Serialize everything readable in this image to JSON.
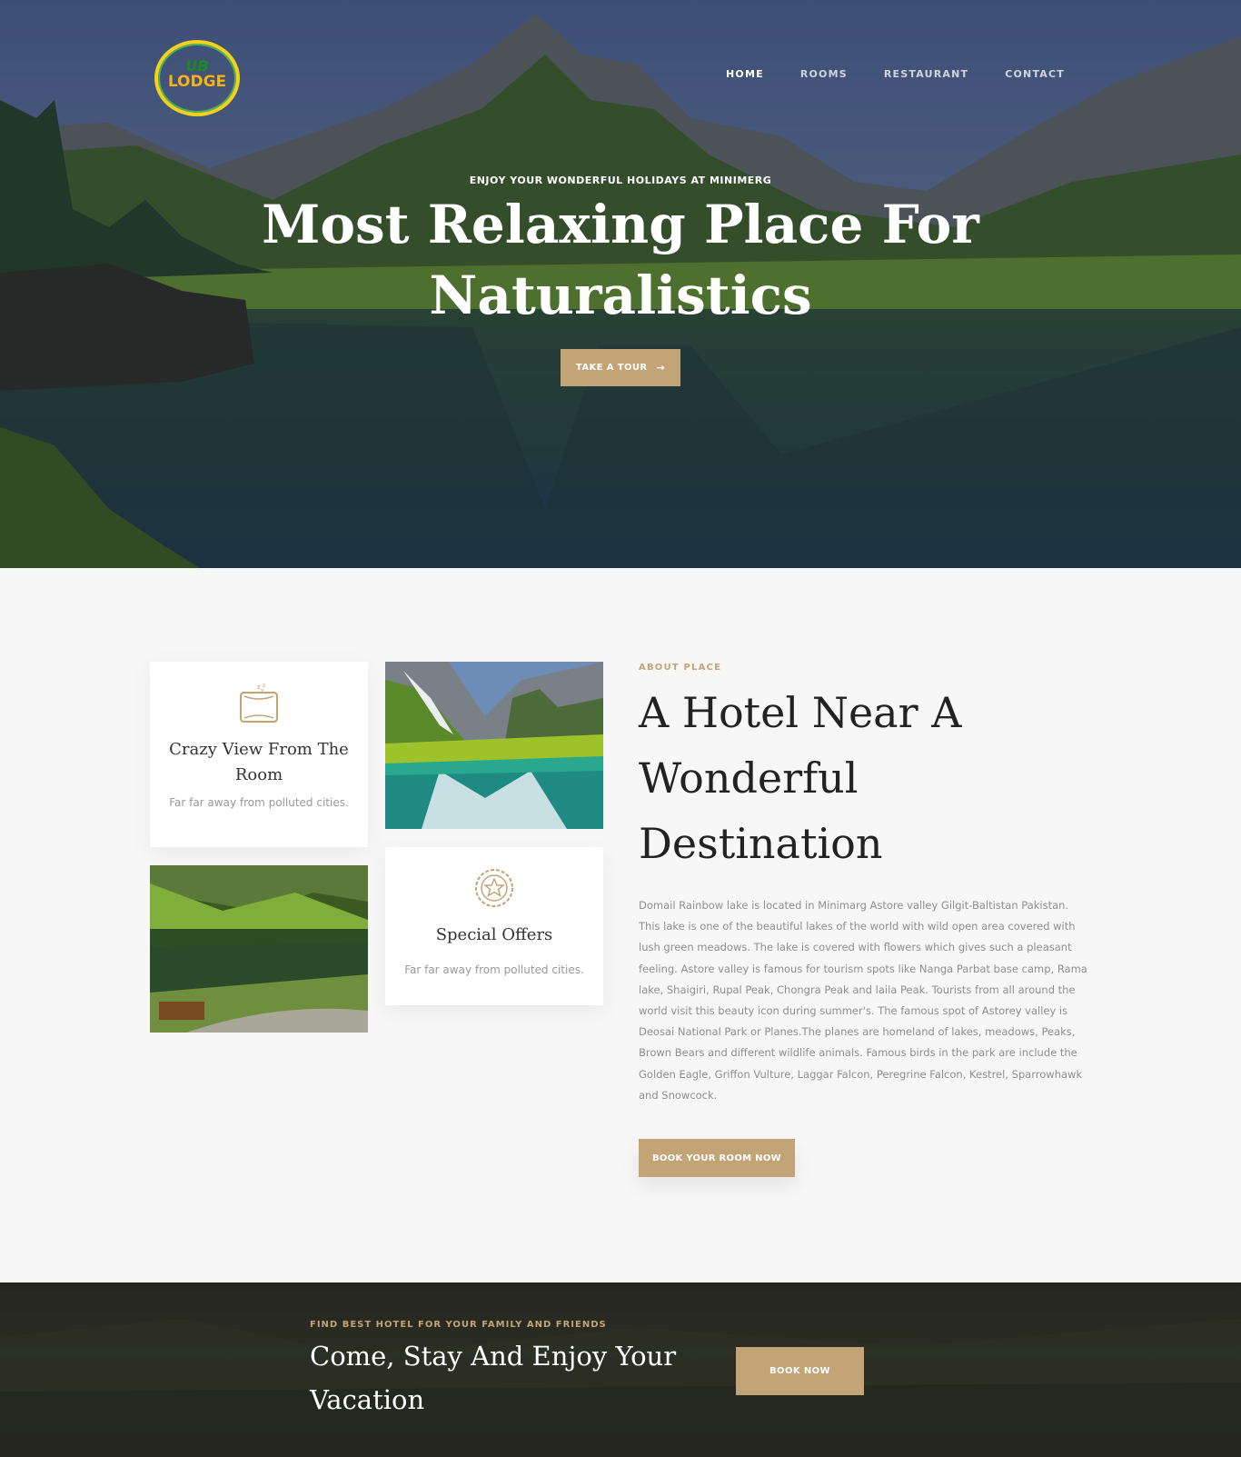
{
  "brand": {
    "logo_line1": "UB",
    "logo_line2": "LODGE"
  },
  "nav": {
    "items": [
      {
        "label": "HOME",
        "active": true
      },
      {
        "label": "ROOMS",
        "active": false
      },
      {
        "label": "RESTAURANT",
        "active": false
      },
      {
        "label": "CONTACT",
        "active": false
      }
    ]
  },
  "hero": {
    "subtitle": "ENJOY YOUR WONDERFUL HOLIDAYS AT MINIMERG",
    "title": "Most Relaxing Place For Naturalistics",
    "cta_label": "TAKE A TOUR",
    "cta_icon": "arrow-right-icon"
  },
  "features": [
    {
      "icon": "pillow-icon",
      "title": "Crazy View From The Room",
      "text": "Far far away from polluted cities."
    },
    {
      "icon": "star-badge-icon",
      "title": "Special Offers",
      "text": "Far far away from polluted cities."
    }
  ],
  "about": {
    "label": "ABOUT PLACE",
    "title": "A Hotel Near A Wonderful Destination",
    "text": "Domail Rainbow lake is located in Minimarg Astore valley Gilgit-Baltistan Pakistan. This lake is one of the beautiful lakes of the world with wild open area covered with lush green meadows. The lake is covered with flowers which gives such a pleasant feeling. Astore valley is famous for tourism spots like Nanga Parbat base camp, Rama lake, Shaigiri, Rupal Peak, Chongra Peak and laila Peak. Tourists from all around the world visit this beauty icon during summer's. The famous spot of Astorey valley is Deosai National Park or Planes.The planes are homeland of lakes, meadows, Peaks, Brown Bears and different wildlife animals. Famous birds in the park are include the Golden Eagle, Griffon Vulture, Laggar Falcon, Peregrine Falcon, Kestrel, Sparrowhawk and Snowcock.",
    "button": "BOOK YOUR ROOM NOW"
  },
  "cta": {
    "label": "FIND BEST HOTEL FOR YOUR FAMILY AND FRIENDS",
    "title": "Come, Stay And Enjoy Your Vacation",
    "button": "BOOK NOW"
  },
  "colors": {
    "accent": "#c2a476",
    "background": "#f7f7f7",
    "heading": "#222222",
    "muted": "#8e8e8e"
  }
}
